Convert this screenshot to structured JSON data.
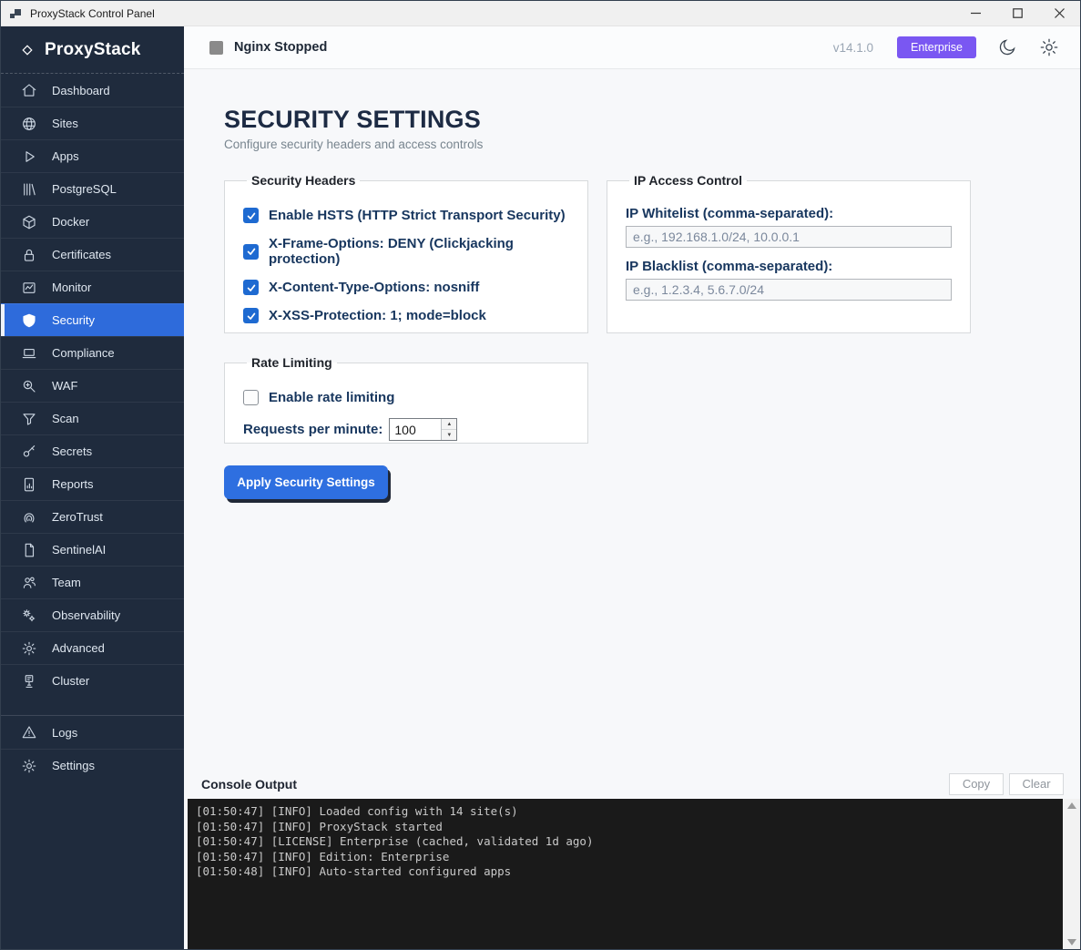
{
  "window": {
    "title": "ProxyStack Control Panel"
  },
  "icons": {
    "app-icon": "two-blocks",
    "minimize-icon": "horizontal-line",
    "maximize-icon": "square",
    "close-icon": "x-cross",
    "logo-icon": "diamond-outline",
    "moon-icon": "crescent-moon",
    "gear-icon": "cog-wheel",
    "status-icon": "gray-square",
    "scroll-up-icon": "triangle-up",
    "scroll-down-icon": "triangle-down"
  },
  "sidebar": {
    "logo": "ProxyStack",
    "items": [
      {
        "label": "Dashboard",
        "icon": "home-icon",
        "active": false
      },
      {
        "label": "Sites",
        "icon": "globe-icon",
        "active": false
      },
      {
        "label": "Apps",
        "icon": "play-icon",
        "active": false
      },
      {
        "label": "PostgreSQL",
        "icon": "database-icon",
        "active": false
      },
      {
        "label": "Docker",
        "icon": "container-icon",
        "active": false
      },
      {
        "label": "Certificates",
        "icon": "lock-icon",
        "active": false
      },
      {
        "label": "Monitor",
        "icon": "chart-icon",
        "active": false
      },
      {
        "label": "Security",
        "icon": "shield-icon",
        "active": true
      },
      {
        "label": "Compliance",
        "icon": "laptop-icon",
        "active": false
      },
      {
        "label": "WAF",
        "icon": "magnifier-plus-icon",
        "active": false
      },
      {
        "label": "Scan",
        "icon": "funnel-icon",
        "active": false
      },
      {
        "label": "Secrets",
        "icon": "key-icon",
        "active": false
      },
      {
        "label": "Reports",
        "icon": "report-icon",
        "active": false
      },
      {
        "label": "ZeroTrust",
        "icon": "fingerprint-icon",
        "active": false
      },
      {
        "label": "SentinelAI",
        "icon": "page-icon",
        "active": false
      },
      {
        "label": "Team",
        "icon": "people-icon",
        "active": false
      },
      {
        "label": "Observability",
        "icon": "gears-icon",
        "active": false
      },
      {
        "label": "Advanced",
        "icon": "gear-icon",
        "active": false
      },
      {
        "label": "Cluster",
        "icon": "server-icon",
        "active": false
      }
    ],
    "footer_items": [
      {
        "label": "Logs",
        "icon": "warning-icon",
        "active": false
      },
      {
        "label": "Settings",
        "icon": "gear-icon",
        "active": false
      }
    ]
  },
  "header": {
    "status_label": "Nginx Stopped",
    "version": "v14.1.0",
    "badge": "Enterprise"
  },
  "page": {
    "title": "SECURITY SETTINGS",
    "subtitle": "Configure security headers and access controls"
  },
  "security_headers": {
    "legend": "Security Headers",
    "options": [
      {
        "label": "Enable HSTS (HTTP Strict Transport Security)",
        "checked": true
      },
      {
        "label": "X-Frame-Options: DENY (Clickjacking protection)",
        "checked": true
      },
      {
        "label": "X-Content-Type-Options: nosniff",
        "checked": true
      },
      {
        "label": "X-XSS-Protection: 1; mode=block",
        "checked": true
      }
    ]
  },
  "ip_access": {
    "legend": "IP Access Control",
    "whitelist_label": "IP Whitelist (comma-separated):",
    "whitelist_placeholder": "e.g., 192.168.1.0/24, 10.0.0.1",
    "whitelist_value": "",
    "blacklist_label": "IP Blacklist (comma-separated):",
    "blacklist_placeholder": "e.g., 1.2.3.4, 5.6.7.0/24",
    "blacklist_value": ""
  },
  "rate_limiting": {
    "legend": "Rate Limiting",
    "enable_label": "Enable rate limiting",
    "enabled": false,
    "rpm_label": "Requests per minute:",
    "rpm_value": "100"
  },
  "apply_button": "Apply Security Settings",
  "console": {
    "title": "Console Output",
    "copy_label": "Copy",
    "clear_label": "Clear",
    "lines": [
      "[01:50:47] [INFO] Loaded config with 14 site(s)",
      "[01:50:47] [INFO] ProxyStack started",
      "[01:50:47] [LICENSE] Enterprise (cached, validated 1d ago)",
      "[01:50:47] [INFO] Edition: Enterprise",
      "[01:50:48] [INFO] Auto-started configured apps"
    ]
  },
  "colors": {
    "sidebar_bg": "#1f2b3d",
    "active_item": "#2e6bdb",
    "accent_blue": "#2e6fe0",
    "checkbox_blue": "#1e6ad1",
    "badge_purple": "#7a57f2",
    "console_bg": "#1a1a1a",
    "status_gray": "#8a8a8a"
  }
}
